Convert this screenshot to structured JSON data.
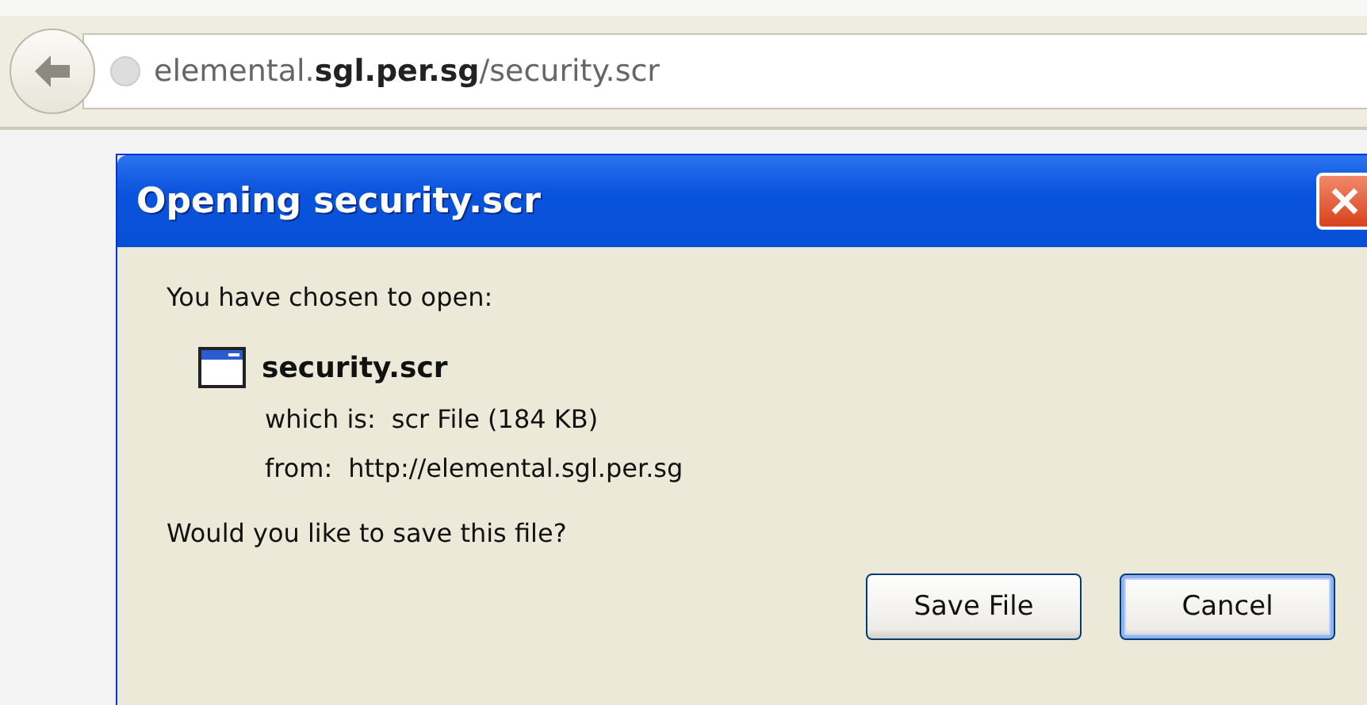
{
  "address_bar": {
    "url": "elemental.**sgl.per.sg**/security.scr"
  },
  "dialog": {
    "title": "Opening security.scr",
    "intro": "You have chosen to open:",
    "file_name": "security.scr",
    "details": [
      {
        "label": "which is:",
        "value": "scr File (184 KB)"
      },
      {
        "label": "from:",
        "value": "http://elemental.sgl.per.sg"
      }
    ],
    "question": "Would you like to save this file?",
    "buttons": [
      {
        "label": "Save File",
        "focused": false
      },
      {
        "label": "Cancel",
        "focused": true
      }
    ]
  }
}
